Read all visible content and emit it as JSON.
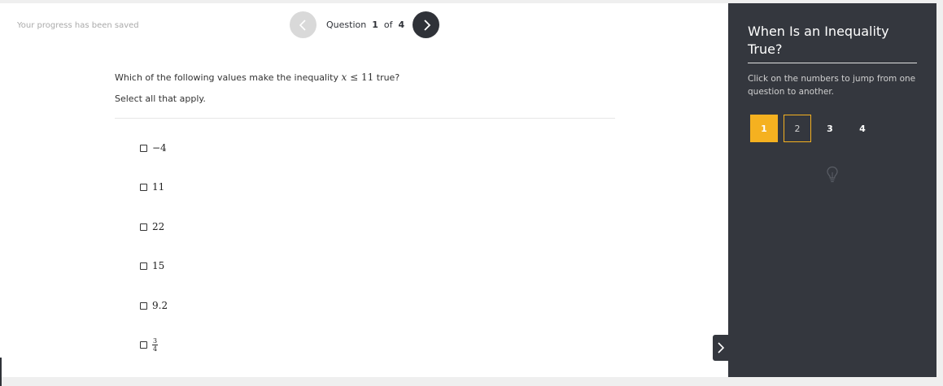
{
  "status": {
    "saved_text": "Your progress has been saved"
  },
  "navigation": {
    "question_word": "Question",
    "current": "1",
    "of_word": "of",
    "total": "4",
    "prev_icon": "chevron-left-icon",
    "next_icon": "chevron-right-icon"
  },
  "question": {
    "prompt_before": "Which of the following values make the inequality",
    "math_var": "x",
    "math_op": "≤",
    "math_value": "11",
    "prompt_after": "true?",
    "hint": "Select all that apply."
  },
  "options": [
    {
      "label": "−4",
      "checked": false
    },
    {
      "label": "11",
      "checked": false
    },
    {
      "label": "22",
      "checked": false
    },
    {
      "label": "15",
      "checked": false
    },
    {
      "label": "9.2",
      "checked": false
    },
    {
      "numerator": "3",
      "denominator": "4",
      "checked": false
    }
  ],
  "panel": {
    "title": "When Is an Inequality True?",
    "description": "Click on the numbers to jump from one question to another.",
    "question_buttons": [
      "1",
      "2",
      "3",
      "4"
    ],
    "active_question": "1",
    "hint_icon": "lightbulb-icon",
    "collapse_icon": "chevron-right-icon"
  },
  "colors": {
    "accent": "#f5b120",
    "panel_bg": "#34373e",
    "nav_dark": "#2f3238",
    "nav_disabled": "#d9d9d9"
  }
}
